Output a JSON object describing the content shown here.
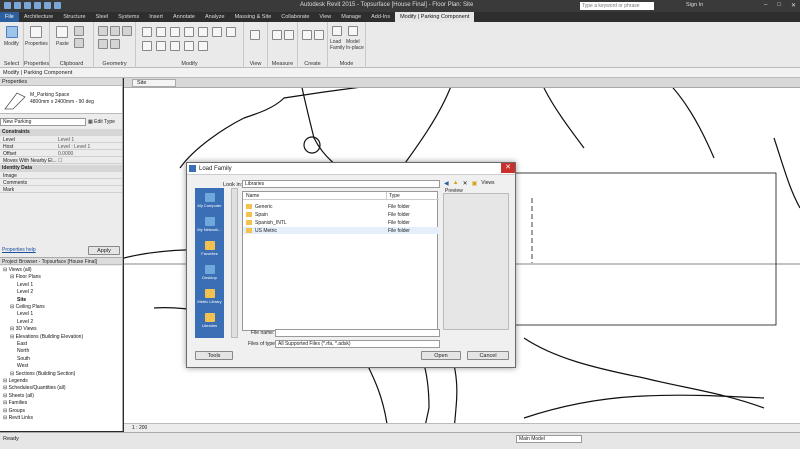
{
  "window": {
    "title": "Autodesk Revit 2015 - Topsurface [House Final] - Floor Plan: Site",
    "search_placeholder": "Type a keyword or phrase",
    "sign_in": "Sign In"
  },
  "tabs": [
    "File",
    "Architecture",
    "Structure",
    "Steel",
    "Systems",
    "Insert",
    "Annotate",
    "Analyze",
    "Massing & Site",
    "Collaborate",
    "View",
    "Manage",
    "Add-Ins",
    "Modify | Parking Component"
  ],
  "ribbon": {
    "groups": [
      "Select",
      "Properties",
      "Clipboard",
      "Geometry",
      "Modify",
      "View",
      "Measure",
      "Create",
      "Mode"
    ],
    "modify_label": "Modify",
    "paste_label": "Paste",
    "properties_label": "Properties",
    "load_family_label": "Load Family",
    "model_in_place_label": "Model In-place"
  },
  "options_bar": {
    "label": "Modify | Parking Component"
  },
  "properties": {
    "title": "Properties",
    "family_name": "M_Parking Space",
    "family_type": "4800mm x 2400mm - 90 deg",
    "type_selector": "New Parking",
    "edit_type": "Edit Type",
    "sections": {
      "constraints": "Constraints",
      "identity": "Identity Data"
    },
    "rows": [
      {
        "k": "Level",
        "v": "Level 1"
      },
      {
        "k": "Host",
        "v": "Level : Level 1"
      },
      {
        "k": "Offset",
        "v": "0.0000"
      },
      {
        "k": "Moves With Nearby El...",
        "v": ""
      }
    ],
    "identity_rows": [
      {
        "k": "Image",
        "v": ""
      },
      {
        "k": "Comments",
        "v": ""
      },
      {
        "k": "Mark",
        "v": ""
      }
    ],
    "help": "Properties help",
    "apply": "Apply"
  },
  "browser": {
    "title": "Project Browser - Topsurface [House Final]",
    "items": [
      {
        "t": "Views (all)",
        "d": 0
      },
      {
        "t": "Floor Plans",
        "d": 1
      },
      {
        "t": "Level 1",
        "d": 2
      },
      {
        "t": "Level 2",
        "d": 2
      },
      {
        "t": "Site",
        "d": 2
      },
      {
        "t": "Ceiling Plans",
        "d": 1
      },
      {
        "t": "Level 1",
        "d": 2
      },
      {
        "t": "Level 2",
        "d": 2
      },
      {
        "t": "3D Views",
        "d": 1
      },
      {
        "t": "Elevations (Building Elevation)",
        "d": 1
      },
      {
        "t": "East",
        "d": 2
      },
      {
        "t": "North",
        "d": 2
      },
      {
        "t": "South",
        "d": 2
      },
      {
        "t": "West",
        "d": 2
      },
      {
        "t": "Sections (Building Section)",
        "d": 1
      },
      {
        "t": "Legends",
        "d": 0
      },
      {
        "t": "Schedules/Quantities (all)",
        "d": 0
      },
      {
        "t": "Sheets (all)",
        "d": 0
      },
      {
        "t": "Families",
        "d": 0
      },
      {
        "t": "Groups",
        "d": 0
      },
      {
        "t": "Revit Links",
        "d": 0
      }
    ]
  },
  "view": {
    "tab": "Site",
    "scale": "1 : 200"
  },
  "status": {
    "text": "Ready",
    "model": "Main Model"
  },
  "dialog": {
    "title": "Load Family",
    "look_in_label": "Look in:",
    "look_in_value": "Libraries",
    "views_label": "Views",
    "preview_label": "Preview",
    "places": [
      "My Computer",
      "My Network...",
      "Favorites",
      "Desktop",
      "Metric Library",
      "Libraries"
    ],
    "columns": {
      "name": "Name",
      "type": "Type"
    },
    "files": [
      {
        "name": "Generic",
        "type": "File folder"
      },
      {
        "name": "Spain",
        "type": "File folder"
      },
      {
        "name": "Spanish_INTL",
        "type": "File folder"
      },
      {
        "name": "US Metric",
        "type": "File folder"
      }
    ],
    "file_name_label": "File name:",
    "file_name_value": "",
    "files_of_type_label": "Files of type:",
    "files_of_type_value": "All Supported Files (*.rfa, *.adsk)",
    "tools": "Tools",
    "open": "Open",
    "cancel": "Cancel"
  }
}
